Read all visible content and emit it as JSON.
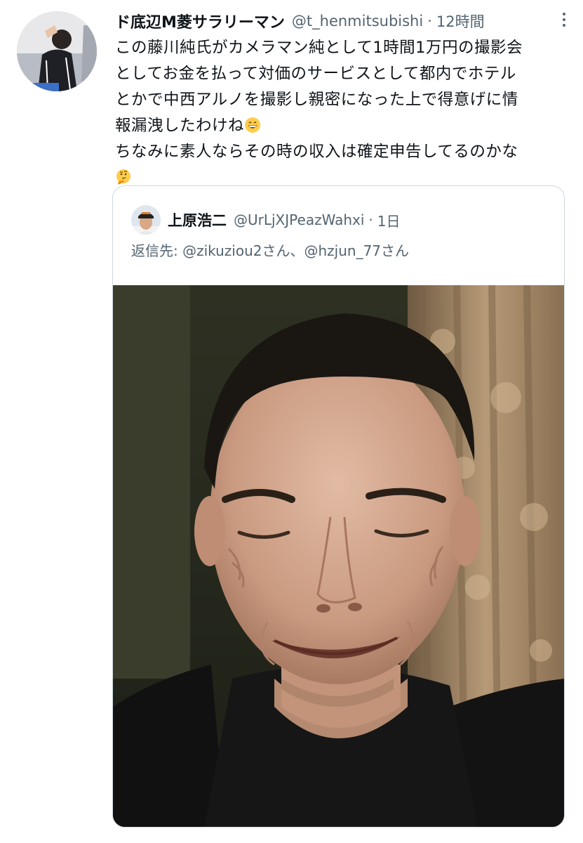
{
  "tweet": {
    "display_name": "ド底辺M菱サラリーマン",
    "handle": "@t_henmitsubishi",
    "separator": "·",
    "time": "12時間",
    "text_lines": [
      "この藤川純氏がカメラマン純として1時間1万円の撮影会",
      "としてお金を払って対価のサービスとして都内でホテル",
      "とかで中西アルノを撮影し親密になった上で得意げに情",
      "報漏洩したわけね",
      "ちなみに素人ならその時の収入は確定申告してるのかな"
    ],
    "emojis": [
      "grinning-face-emoji",
      "thinking-face-emoji"
    ],
    "more_icon": "more-options-icon"
  },
  "quote": {
    "display_name": "上原浩二",
    "handle": "@UrLjXJPeazWahxi",
    "separator": "·",
    "time": "1日",
    "reply_prefix": "返信先: ",
    "reply_to_1": "@zikuziou2さん",
    "reply_sep": "、",
    "reply_to_2": "@hzjun_77さん",
    "media_icon": "photo-smiling-man"
  },
  "colors": {
    "text_primary": "#0f1419",
    "text_secondary": "#536471",
    "border": "#cfd9de",
    "background": "#ffffff"
  }
}
